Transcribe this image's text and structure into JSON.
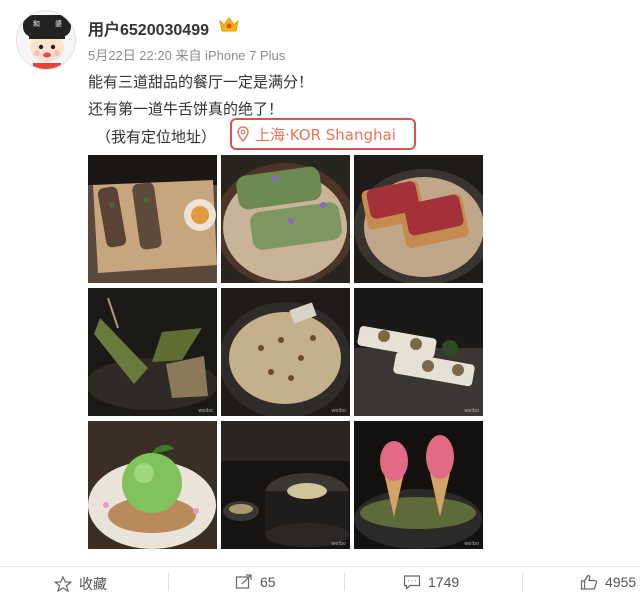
{
  "post": {
    "username": "用户6520030499",
    "meta": "5月22日 22:20 来自 iPhone 7 Plus",
    "lines": [
      "能有三道甜品的餐厅一定是满分！",
      "还有第一道牛舌饼真的绝了！",
      "（我有定位地址）"
    ],
    "location": "上海·KOR Shanghai",
    "photos": [
      "photo-1",
      "photo-2",
      "photo-3",
      "photo-4",
      "photo-5",
      "photo-6",
      "photo-7",
      "photo-8",
      "photo-9"
    ]
  },
  "toolbar": {
    "favorite": "收藏",
    "repost": "65",
    "comment": "1749",
    "like": "4955"
  },
  "colors": {
    "location": "#eb7350",
    "highlight_box": "#d9534f",
    "vip": "#f7b500"
  },
  "icons": [
    "avatar",
    "vip-crown-icon",
    "location-pin-icon",
    "star-icon",
    "share-icon",
    "comment-icon",
    "thumbs-up-icon"
  ]
}
